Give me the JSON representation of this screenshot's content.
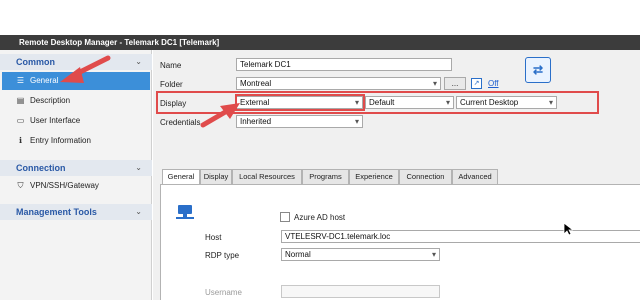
{
  "window": {
    "title": "Remote Desktop Manager - Telemark DC1 [Telemark]"
  },
  "sidebar": {
    "groups": [
      {
        "label": "Common"
      },
      {
        "label": "Connection"
      },
      {
        "label": "Management Tools"
      }
    ],
    "items": [
      {
        "label": "General",
        "icon": "list-icon"
      },
      {
        "label": "Description",
        "icon": "document-icon"
      },
      {
        "label": "User Interface",
        "icon": "monitor-icon"
      },
      {
        "label": "Entry Information",
        "icon": "info-icon"
      },
      {
        "label": "VPN/SSH/Gateway",
        "icon": "shield-icon"
      }
    ],
    "chevron": "⌄"
  },
  "form": {
    "name": {
      "label": "Name",
      "value": "Telemark DC1"
    },
    "folder": {
      "label": "Folder",
      "value": "Montreal",
      "browse": "...",
      "off_link": "Off"
    },
    "display": {
      "label": "Display",
      "mode": "External",
      "position": "Default",
      "desktop": "Current Desktop"
    },
    "credentials": {
      "label": "Credentials",
      "value": "Inherited"
    }
  },
  "tabs": [
    "General",
    "Display",
    "Local Resources",
    "Programs",
    "Experience",
    "Connection",
    "Advanced"
  ],
  "general_tab": {
    "azure_ad_host": "Azure AD host",
    "host": {
      "label": "Host",
      "value": "VTELESRV-DC1.telemark.loc"
    },
    "rdp_type": {
      "label": "RDP type",
      "value": "Normal"
    },
    "username": {
      "label": "Username",
      "value": ""
    }
  },
  "colors": {
    "accent": "#3c8fd9",
    "annotation": "#e04b4b",
    "group_header_text": "#2a59a6"
  }
}
